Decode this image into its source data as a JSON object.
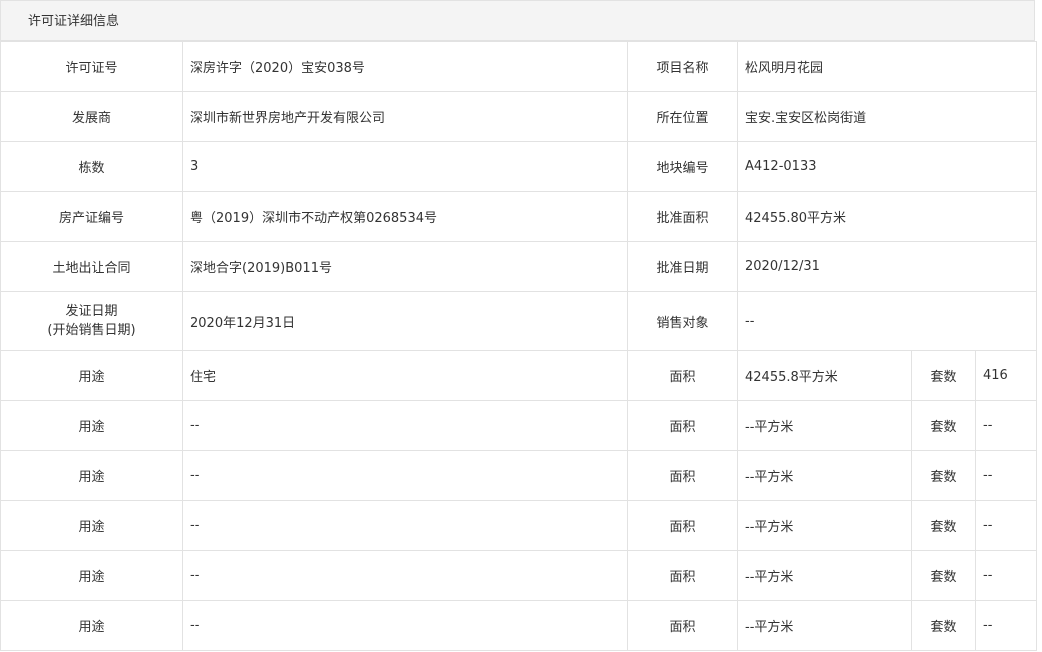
{
  "header": {
    "title": "许可证详细信息"
  },
  "rows": [
    {
      "l1": "许可证号",
      "v1": "深房许字（2020）宝安038号",
      "l2": "项目名称",
      "v2": "松风明月花园"
    },
    {
      "l1": "发展商",
      "v1": "深圳市新世界房地产开发有限公司",
      "l2": "所在位置",
      "v2": "宝安.宝安区松岗街道"
    },
    {
      "l1": "栋数",
      "v1": "3",
      "l2": "地块编号",
      "v2": "A412-0133"
    },
    {
      "l1": "房产证编号",
      "v1": "粤（2019）深圳市不动产权第0268534号",
      "l2": "批准面积",
      "v2": "42455.80平方米"
    },
    {
      "l1": "土地出让合同",
      "v1": "深地合字(2019)B011号",
      "l2": "批准日期",
      "v2": "2020/12/31"
    },
    {
      "l1_line1": "发证日期",
      "l1_line2": "(开始销售日期)",
      "v1": "2020年12月31日",
      "l2": "销售对象",
      "v2": "--"
    }
  ],
  "usage_rows": [
    {
      "usage_label": "用途",
      "usage": "住宅",
      "area_label": "面积",
      "area": "42455.8平方米",
      "units_label": "套数",
      "units": "416"
    },
    {
      "usage_label": "用途",
      "usage": "--",
      "area_label": "面积",
      "area": "--平方米",
      "units_label": "套数",
      "units": "--"
    },
    {
      "usage_label": "用途",
      "usage": "--",
      "area_label": "面积",
      "area": "--平方米",
      "units_label": "套数",
      "units": "--"
    },
    {
      "usage_label": "用途",
      "usage": "--",
      "area_label": "面积",
      "area": "--平方米",
      "units_label": "套数",
      "units": "--"
    },
    {
      "usage_label": "用途",
      "usage": "--",
      "area_label": "面积",
      "area": "--平方米",
      "units_label": "套数",
      "units": "--"
    },
    {
      "usage_label": "用途",
      "usage": "--",
      "area_label": "面积",
      "area": "--平方米",
      "units_label": "套数",
      "units": "--"
    }
  ]
}
